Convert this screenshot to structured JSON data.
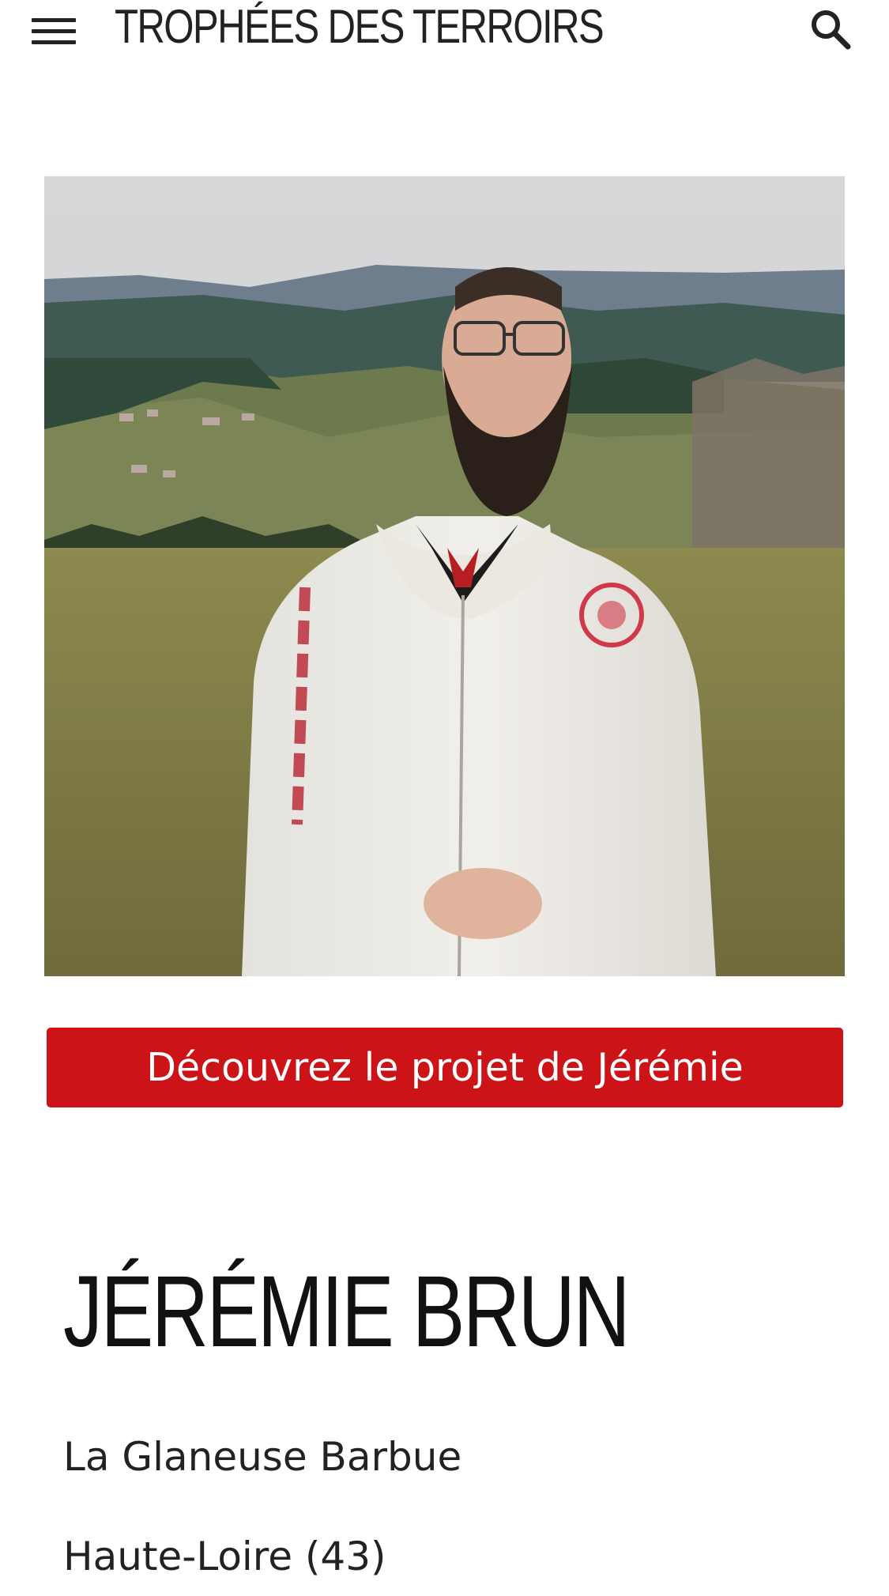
{
  "header": {
    "site_title": "TROPHÉES DES TERROIRS",
    "menu_icon": "hamburger-icon",
    "search_icon": "search-icon"
  },
  "hero": {
    "image": "portrait-photo"
  },
  "cta": {
    "label": "Découvrez le projet de Jérémie",
    "color": "#cc1418"
  },
  "profile": {
    "name": "JÉRÉMIE BRUN",
    "business": "La Glaneuse Barbue",
    "department": "Haute-Loire (43)"
  }
}
